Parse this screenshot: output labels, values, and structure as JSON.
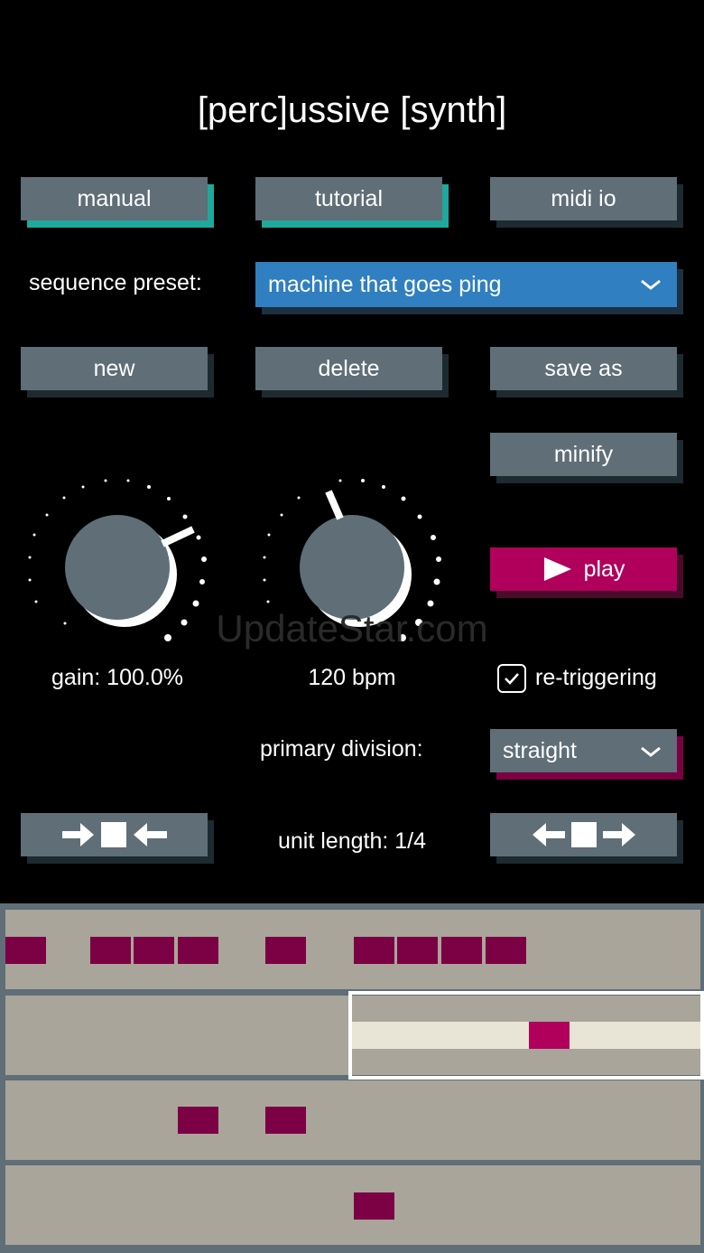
{
  "app_title": "[perc]ussive [synth]",
  "buttons": {
    "manual": "manual",
    "tutorial": "tutorial",
    "midi_io": "midi io",
    "new": "new",
    "delete": "delete",
    "save_as": "save as",
    "minify": "minify",
    "play": "play"
  },
  "sequence_preset": {
    "label": "sequence preset:",
    "value": "machine that goes ping"
  },
  "knobs": {
    "gain_label": "gain: 100.0%",
    "bpm_label": "120 bpm"
  },
  "retriggering": {
    "label": "re-triggering",
    "checked": true
  },
  "primary_division": {
    "label": "primary division:",
    "value": "straight"
  },
  "unit_length": "unit length: 1/4",
  "watermark": "UpdateStar.com",
  "colors": {
    "background": "#000000",
    "button": "#5f6e77",
    "teal_shadow": "#1fa89b",
    "dropdown_blue": "#2f7fc1",
    "play_magenta": "#b0005c",
    "sequencer_bg": "#a9a59b",
    "step_active": "#7b0044",
    "step_selected": "#b0005c"
  }
}
